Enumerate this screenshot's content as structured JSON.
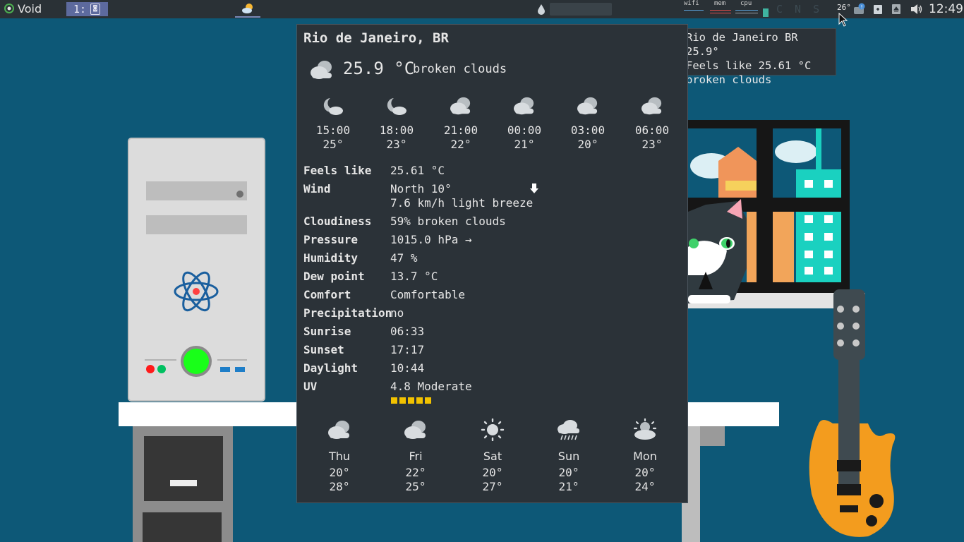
{
  "panel": {
    "app_name": "Void",
    "workspace": "1:",
    "workspace_doc_glyph": "◙",
    "monitors": [
      {
        "label": "wifi",
        "color": "#5aa0d8"
      },
      {
        "label": "mem",
        "color": "#e04a4a"
      },
      {
        "label": "cpu",
        "color": "#5aa0d8"
      }
    ],
    "caps_indicator": "C N S",
    "tray_temp": "26°",
    "clock": "12:49"
  },
  "tooltip": {
    "line1": "Rio de Janeiro BR 25.9°",
    "line2": "Feels like 25.61 °C",
    "line3": "broken clouds"
  },
  "weather": {
    "location": "Rio de Janeiro, BR",
    "current_temp": "25.9 °C",
    "current_desc": "broken clouds",
    "current_icon": "broken-clouds-icon",
    "hourly": [
      {
        "time": "15:00",
        "temp": "25°",
        "icon": "moon-cloud-icon"
      },
      {
        "time": "18:00",
        "temp": "23°",
        "icon": "moon-cloud-icon"
      },
      {
        "time": "21:00",
        "temp": "22°",
        "icon": "broken-clouds-icon"
      },
      {
        "time": "00:00",
        "temp": "21°",
        "icon": "broken-clouds-icon"
      },
      {
        "time": "03:00",
        "temp": "20°",
        "icon": "broken-clouds-icon"
      },
      {
        "time": "06:00",
        "temp": "23°",
        "icon": "broken-clouds-icon"
      }
    ],
    "details": [
      {
        "label": "Feels like",
        "value": "25.61 °C"
      },
      {
        "label": "Wind",
        "value": "North 10°",
        "value2": "7.6 km/h light breeze"
      },
      {
        "label": "Cloudiness",
        "value": "59% broken clouds"
      },
      {
        "label": "Pressure",
        "value": "1015.0 hPa →"
      },
      {
        "label": "Humidity",
        "value": "47 %"
      },
      {
        "label": "Dew point",
        "value": "13.7 °C"
      },
      {
        "label": "Comfort",
        "value": "Comfortable"
      },
      {
        "label": "Precipitation",
        "value": "no"
      },
      {
        "label": "Sunrise",
        "value": "06:33"
      },
      {
        "label": "Sunset",
        "value": "17:17"
      },
      {
        "label": "Daylight",
        "value": "10:44"
      },
      {
        "label": "UV",
        "value": "4.8 Moderate"
      }
    ],
    "uv_level_boxes": 5,
    "uv_color": "#f2c200",
    "daily": [
      {
        "day": "Thu",
        "low": "20°",
        "high": "28°",
        "icon": "broken-clouds-icon"
      },
      {
        "day": "Fri",
        "low": "22°",
        "high": "25°",
        "icon": "broken-clouds-icon"
      },
      {
        "day": "Sat",
        "low": "20°",
        "high": "27°",
        "icon": "sun-icon"
      },
      {
        "day": "Sun",
        "low": "20°",
        "high": "21°",
        "icon": "rain-icon"
      },
      {
        "day": "Mon",
        "low": "20°",
        "high": "24°",
        "icon": "sun-cloud-icon"
      }
    ]
  }
}
